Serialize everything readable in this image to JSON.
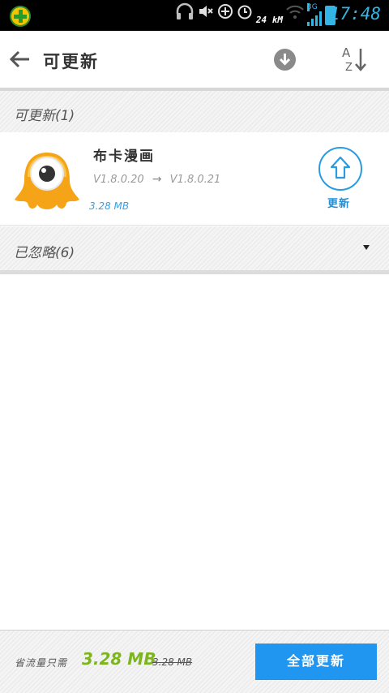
{
  "status_bar": {
    "speed": "24 kM",
    "network_type": "3G",
    "time": "17:48",
    "accent_color": "#33b5e5"
  },
  "header": {
    "title": "可更新",
    "back_icon": "arrow-left-icon",
    "download_icon": "download-circle-icon",
    "sort_icon": "sort-az-icon"
  },
  "sections": {
    "updatable": {
      "label": "可更新(1)"
    },
    "ignored": {
      "label": "已忽略(6)",
      "toggle_icon": "triangle-down-icon"
    }
  },
  "apps": [
    {
      "name": "布卡漫画",
      "current_version": "V1.8.0.20",
      "new_version": "V1.8.0.21",
      "size": "3.28 MB",
      "update_label": "更新",
      "icon": "buka-manga-app-icon"
    }
  ],
  "footer": {
    "save_prefix": "省流量只需",
    "save_amount": "3.28 MB",
    "original_amount": "3.28 MB",
    "update_all_label": "全部更新",
    "accent_color": "#2196f0"
  }
}
